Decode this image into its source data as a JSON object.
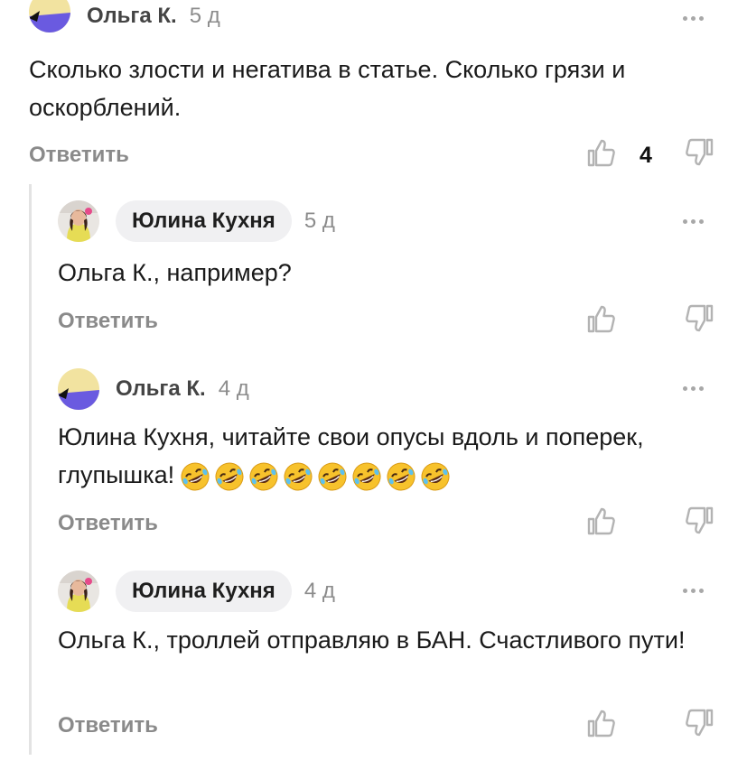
{
  "comments": [
    {
      "author": "Ольга К.",
      "time": "5 д",
      "text": "Сколько злости и негатива в статье. Сколько грязи и оскорблений.",
      "reply_label": "Ответить",
      "likes": "4",
      "avatar_icon": "yellow-purple-avatar-icon"
    },
    {
      "author": "Юлина Кухня",
      "time": "5 д",
      "text": "Ольга К., например?",
      "reply_label": "Ответить",
      "avatar_icon": "photo-avatar-icon"
    },
    {
      "author": "Ольга К.",
      "time": "4 д",
      "text": "Юлина Кухня, читайте свои опусы вдоль и поперек, глупышка!",
      "emoji_name": "rolling-on-floor-laughing-emoji",
      "emoji_count": 8,
      "reply_label": "Ответить",
      "avatar_icon": "yellow-purple-avatar-icon"
    },
    {
      "author": "Юлина Кухня",
      "time": "4 д",
      "text": "Ольга К., троллей отправляю в БАН. Счастливого пути!",
      "reply_label": "Ответить",
      "avatar_icon": "photo-avatar-icon"
    }
  ],
  "colors": {
    "avatar_yellow": "#f2e3a0",
    "avatar_purple": "#6a5ae0",
    "muted_text": "#8a8a8a",
    "badge_bg": "#f0f0f2"
  }
}
